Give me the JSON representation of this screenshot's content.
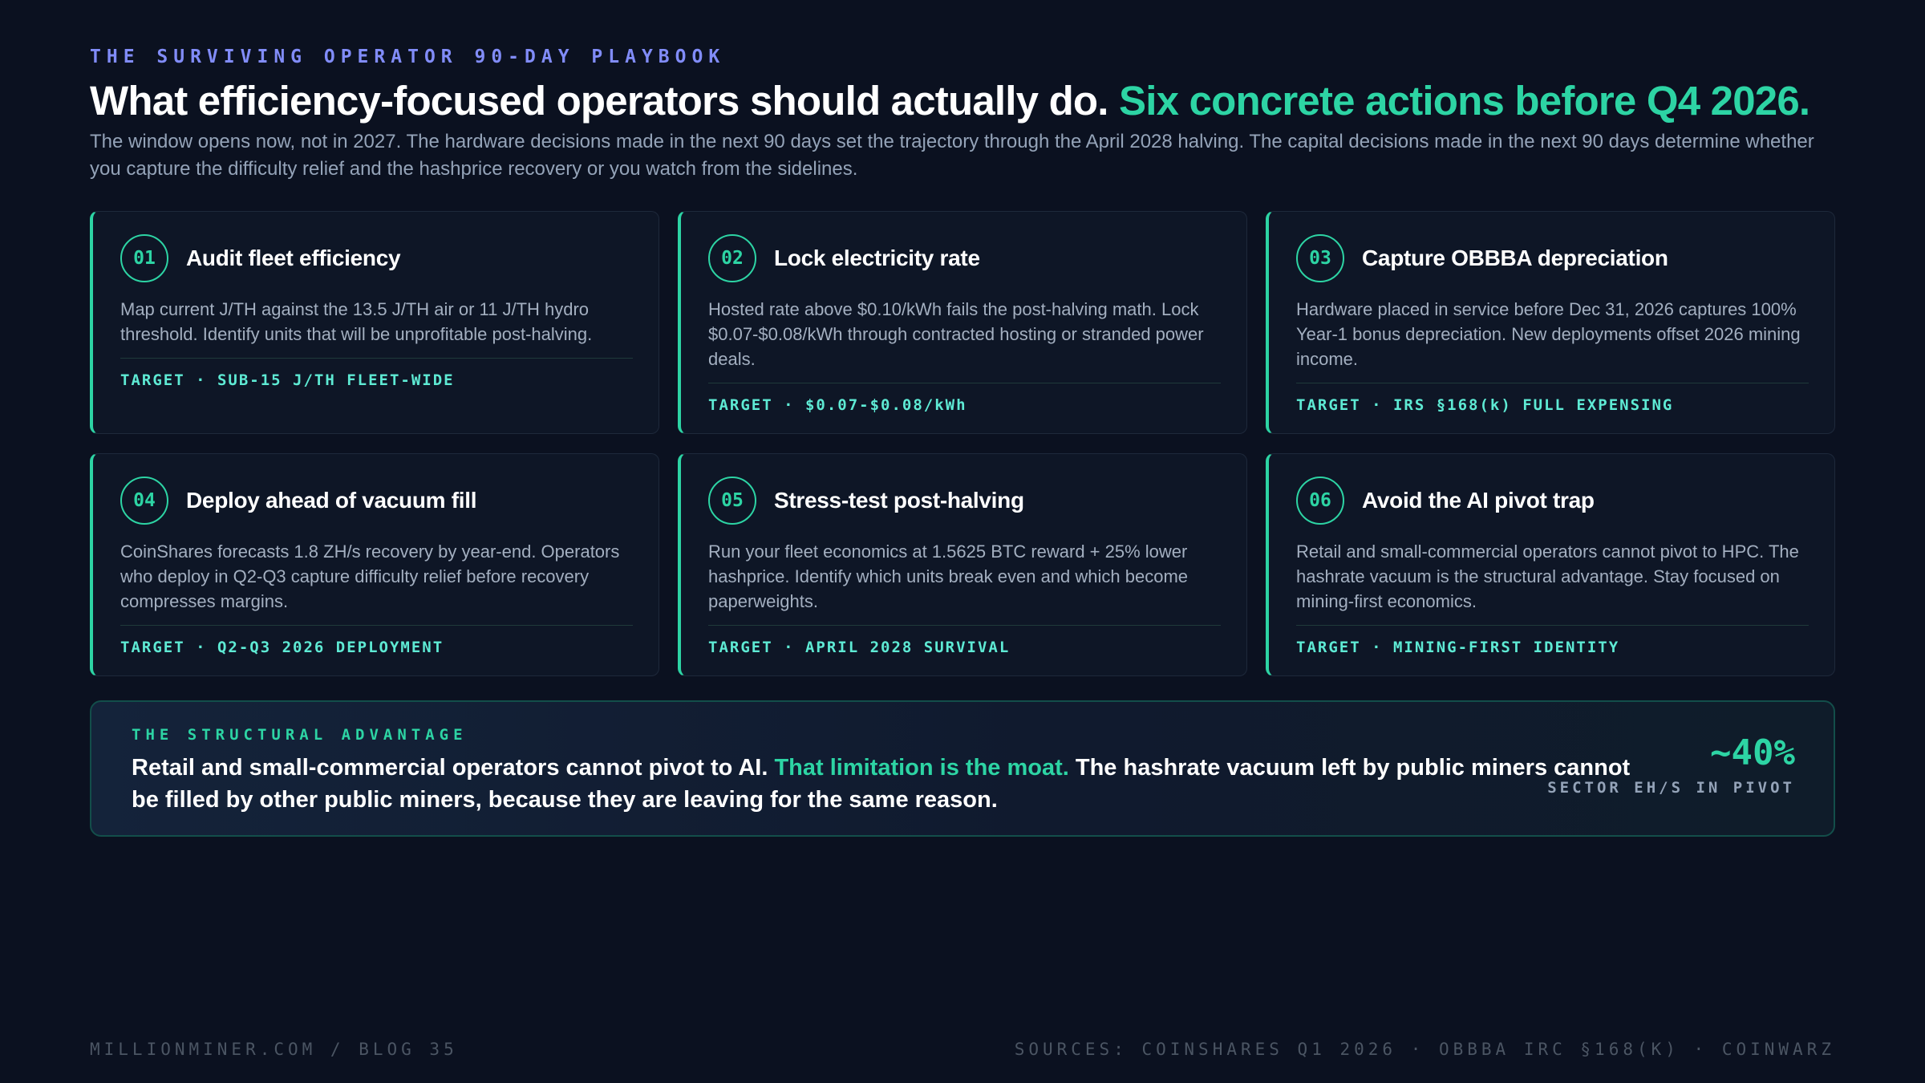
{
  "header": {
    "eyebrow": "THE SURVIVING OPERATOR 90-DAY PLAYBOOK",
    "headline_main": "What efficiency-focused operators should actually do.",
    "headline_accent": "Six concrete actions before Q4 2026.",
    "intro": "The window opens now, not in 2027. The hardware decisions made in the next 90 days set the trajectory through the April 2028 halving. The capital decisions made in the next 90 days determine whether you capture the difficulty relief and the hashprice recovery or you watch from the sidelines."
  },
  "cards": [
    {
      "number": "01",
      "title": "Audit fleet efficiency",
      "body": "Map current J/TH against the 13.5 J/TH air or 11 J/TH hydro threshold. Identify units that will be unprofitable post-halving.",
      "target": "TARGET · SUB-15 J/TH FLEET-WIDE"
    },
    {
      "number": "02",
      "title": "Lock electricity rate",
      "body": "Hosted rate above $0.10/kWh fails the post-halving math. Lock $0.07-$0.08/kWh through contracted hosting or stranded power deals.",
      "target": "TARGET · $0.07-$0.08/kWh"
    },
    {
      "number": "03",
      "title": "Capture OBBBA depreciation",
      "body": "Hardware placed in service before Dec 31, 2026 captures 100% Year-1 bonus depreciation. New deployments offset 2026 mining income.",
      "target": "TARGET · IRS §168(k) FULL EXPENSING"
    },
    {
      "number": "04",
      "title": "Deploy ahead of vacuum fill",
      "body": "CoinShares forecasts 1.8 ZH/s recovery by year-end. Operators who deploy in Q2-Q3 capture difficulty relief before recovery compresses margins.",
      "target": "TARGET · Q2-Q3 2026 DEPLOYMENT"
    },
    {
      "number": "05",
      "title": "Stress-test post-halving",
      "body": "Run your fleet economics at 1.5625 BTC reward + 25% lower hashprice. Identify which units break even and which become paperweights.",
      "target": "TARGET · APRIL 2028 SURVIVAL"
    },
    {
      "number": "06",
      "title": "Avoid the AI pivot trap",
      "body": "Retail and small-commercial operators cannot pivot to HPC. The hashrate vacuum is the structural advantage. Stay focused on mining-first economics.",
      "target": "TARGET · MINING-FIRST IDENTITY"
    }
  ],
  "callout": {
    "label": "THE STRUCTURAL ADVANTAGE",
    "text_before": "Retail and small-commercial operators cannot pivot to AI.",
    "text_accent": "That limitation is the moat.",
    "text_after": "The hashrate vacuum left by public miners cannot be filled by other public miners, because they are leaving for the same reason.",
    "stat_value": "~40%",
    "stat_label": "SECTOR EH/S IN PIVOT"
  },
  "footer": {
    "left": "MILLIONMINER.COM / BLOG 35",
    "right": "SOURCES: COINSHARES Q1 2026 · OBBBA IRC §168(K) · COINWARZ"
  },
  "colors": {
    "background": "#0b1120",
    "accent": "#2dd4a4",
    "eyebrow": "#818cf8"
  }
}
